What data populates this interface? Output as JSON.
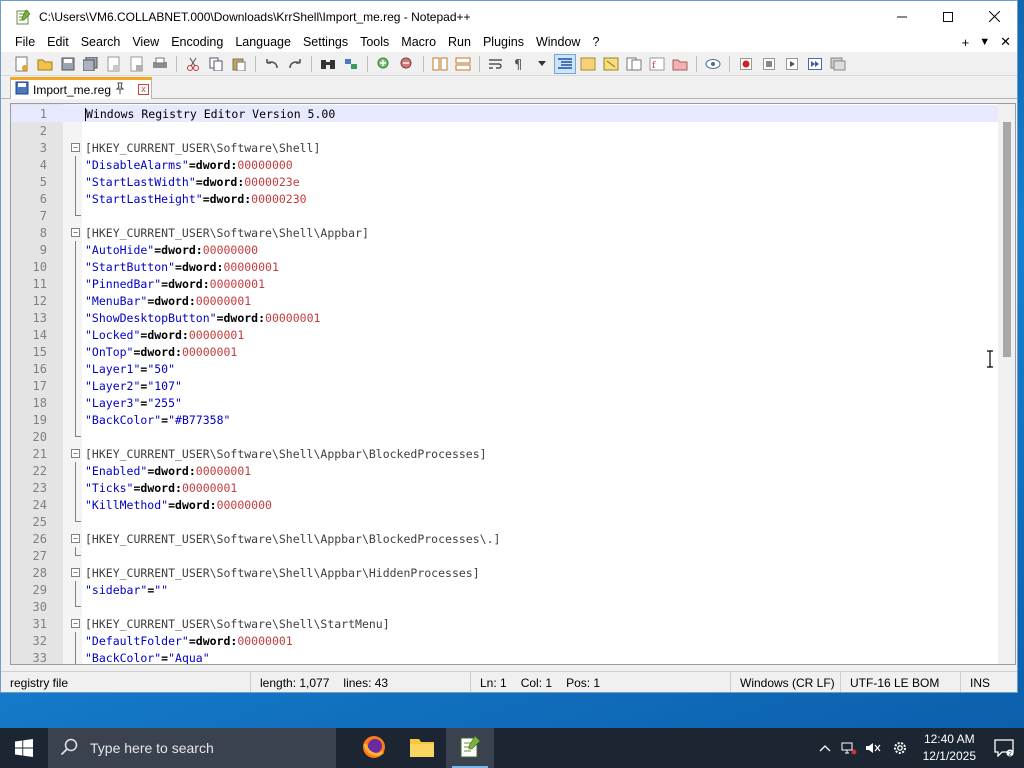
{
  "window": {
    "title": "C:\\Users\\VM6.COLLABNET.000\\Downloads\\KrrShell\\Import_me.reg - Notepad++",
    "controls": {
      "minimize": "—",
      "maximize": "☐",
      "close": "✕"
    }
  },
  "menu": {
    "items": [
      "File",
      "Edit",
      "Search",
      "View",
      "Encoding",
      "Language",
      "Settings",
      "Tools",
      "Macro",
      "Run",
      "Plugins",
      "Window",
      "?"
    ],
    "right": {
      "plus": "+",
      "dropdown": "▼",
      "close": "✕"
    }
  },
  "tab": {
    "label": "Import_me.reg",
    "close": "x"
  },
  "editor": {
    "lines": [
      {
        "n": "1",
        "text": "Windows Registry Editor Version 5.00",
        "kind": "plain",
        "fold": "none"
      },
      {
        "n": "2",
        "text": "",
        "kind": "plain",
        "fold": "none"
      },
      {
        "n": "3",
        "text": "[HKEY_CURRENT_USER\\Software\\Shell]",
        "kind": "section",
        "fold": "start"
      },
      {
        "n": "4",
        "key": "\"DisableAlarms\"",
        "op": "=dword:",
        "val": "00000000",
        "kind": "kv",
        "fold": "line"
      },
      {
        "n": "5",
        "key": "\"StartLastWidth\"",
        "op": "=dword:",
        "val": "0000023e",
        "kind": "kv",
        "fold": "line"
      },
      {
        "n": "6",
        "key": "\"StartLastHeight\"",
        "op": "=dword:",
        "val": "00000230",
        "kind": "kv",
        "fold": "line"
      },
      {
        "n": "7",
        "text": "",
        "kind": "plain",
        "fold": "end"
      },
      {
        "n": "8",
        "text": "[HKEY_CURRENT_USER\\Software\\Shell\\Appbar]",
        "kind": "section",
        "fold": "start"
      },
      {
        "n": "9",
        "key": "\"AutoHide\"",
        "op": "=dword:",
        "val": "00000000",
        "kind": "kv",
        "fold": "line"
      },
      {
        "n": "10",
        "key": "\"StartButton\"",
        "op": "=dword:",
        "val": "00000001",
        "kind": "kv",
        "fold": "line"
      },
      {
        "n": "11",
        "key": "\"PinnedBar\"",
        "op": "=dword:",
        "val": "00000001",
        "kind": "kv",
        "fold": "line"
      },
      {
        "n": "12",
        "key": "\"MenuBar\"",
        "op": "=dword:",
        "val": "00000001",
        "kind": "kv",
        "fold": "line"
      },
      {
        "n": "13",
        "key": "\"ShowDesktopButton\"",
        "op": "=dword:",
        "val": "00000001",
        "kind": "kv",
        "fold": "line"
      },
      {
        "n": "14",
        "key": "\"Locked\"",
        "op": "=dword:",
        "val": "00000001",
        "kind": "kv",
        "fold": "line"
      },
      {
        "n": "15",
        "key": "\"OnTop\"",
        "op": "=dword:",
        "val": "00000001",
        "kind": "kv",
        "fold": "line"
      },
      {
        "n": "16",
        "key": "\"Layer1\"",
        "op": "=",
        "val": "\"50\"",
        "kind": "kvs",
        "fold": "line"
      },
      {
        "n": "17",
        "key": "\"Layer2\"",
        "op": "=",
        "val": "\"107\"",
        "kind": "kvs",
        "fold": "line"
      },
      {
        "n": "18",
        "key": "\"Layer3\"",
        "op": "=",
        "val": "\"255\"",
        "kind": "kvs",
        "fold": "line"
      },
      {
        "n": "19",
        "key": "\"BackColor\"",
        "op": "=",
        "val": "\"#B77358\"",
        "kind": "kvs",
        "fold": "line"
      },
      {
        "n": "20",
        "text": "",
        "kind": "plain",
        "fold": "end"
      },
      {
        "n": "21",
        "text": "[HKEY_CURRENT_USER\\Software\\Shell\\Appbar\\BlockedProcesses]",
        "kind": "section",
        "fold": "start"
      },
      {
        "n": "22",
        "key": "\"Enabled\"",
        "op": "=dword:",
        "val": "00000001",
        "kind": "kv",
        "fold": "line"
      },
      {
        "n": "23",
        "key": "\"Ticks\"",
        "op": "=dword:",
        "val": "00000001",
        "kind": "kv",
        "fold": "line"
      },
      {
        "n": "24",
        "key": "\"KillMethod\"",
        "op": "=dword:",
        "val": "00000000",
        "kind": "kv",
        "fold": "line"
      },
      {
        "n": "25",
        "text": "",
        "kind": "plain",
        "fold": "end"
      },
      {
        "n": "26",
        "text": "[HKEY_CURRENT_USER\\Software\\Shell\\Appbar\\BlockedProcesses\\.]",
        "kind": "section",
        "fold": "start"
      },
      {
        "n": "27",
        "text": "",
        "kind": "plain",
        "fold": "end"
      },
      {
        "n": "28",
        "text": "[HKEY_CURRENT_USER\\Software\\Shell\\Appbar\\HiddenProcesses]",
        "kind": "section",
        "fold": "start"
      },
      {
        "n": "29",
        "key": "\"sidebar\"",
        "op": "=",
        "val": "\"\"",
        "kind": "kvs",
        "fold": "line"
      },
      {
        "n": "30",
        "text": "",
        "kind": "plain",
        "fold": "end"
      },
      {
        "n": "31",
        "text": "[HKEY_CURRENT_USER\\Software\\Shell\\StartMenu]",
        "kind": "section",
        "fold": "start"
      },
      {
        "n": "32",
        "key": "\"DefaultFolder\"",
        "op": "=dword:",
        "val": "00000001",
        "kind": "kv",
        "fold": "line"
      },
      {
        "n": "33",
        "key": "\"BackColor\"",
        "op": "=",
        "val": "\"Aqua\"",
        "kind": "kvs",
        "fold": "line"
      }
    ]
  },
  "status": {
    "type": "registry file",
    "length": "length: 1,077",
    "lines": "lines: 43",
    "ln": "Ln: 1",
    "col": "Col: 1",
    "pos": "Pos: 1",
    "eol": "Windows (CR LF)",
    "encoding": "UTF-16 LE BOM",
    "mode": "INS"
  },
  "taskbar": {
    "search_placeholder": "Type here to search",
    "apps": [
      "firefox-icon",
      "file-explorer-icon",
      "notepadpp-icon"
    ],
    "time": "12:40 AM",
    "date": "12/1/2025"
  },
  "colors": {
    "section": "#404040",
    "key": "#0000c8",
    "value": "#c43c3c",
    "current_line": "#e8e8ff"
  }
}
